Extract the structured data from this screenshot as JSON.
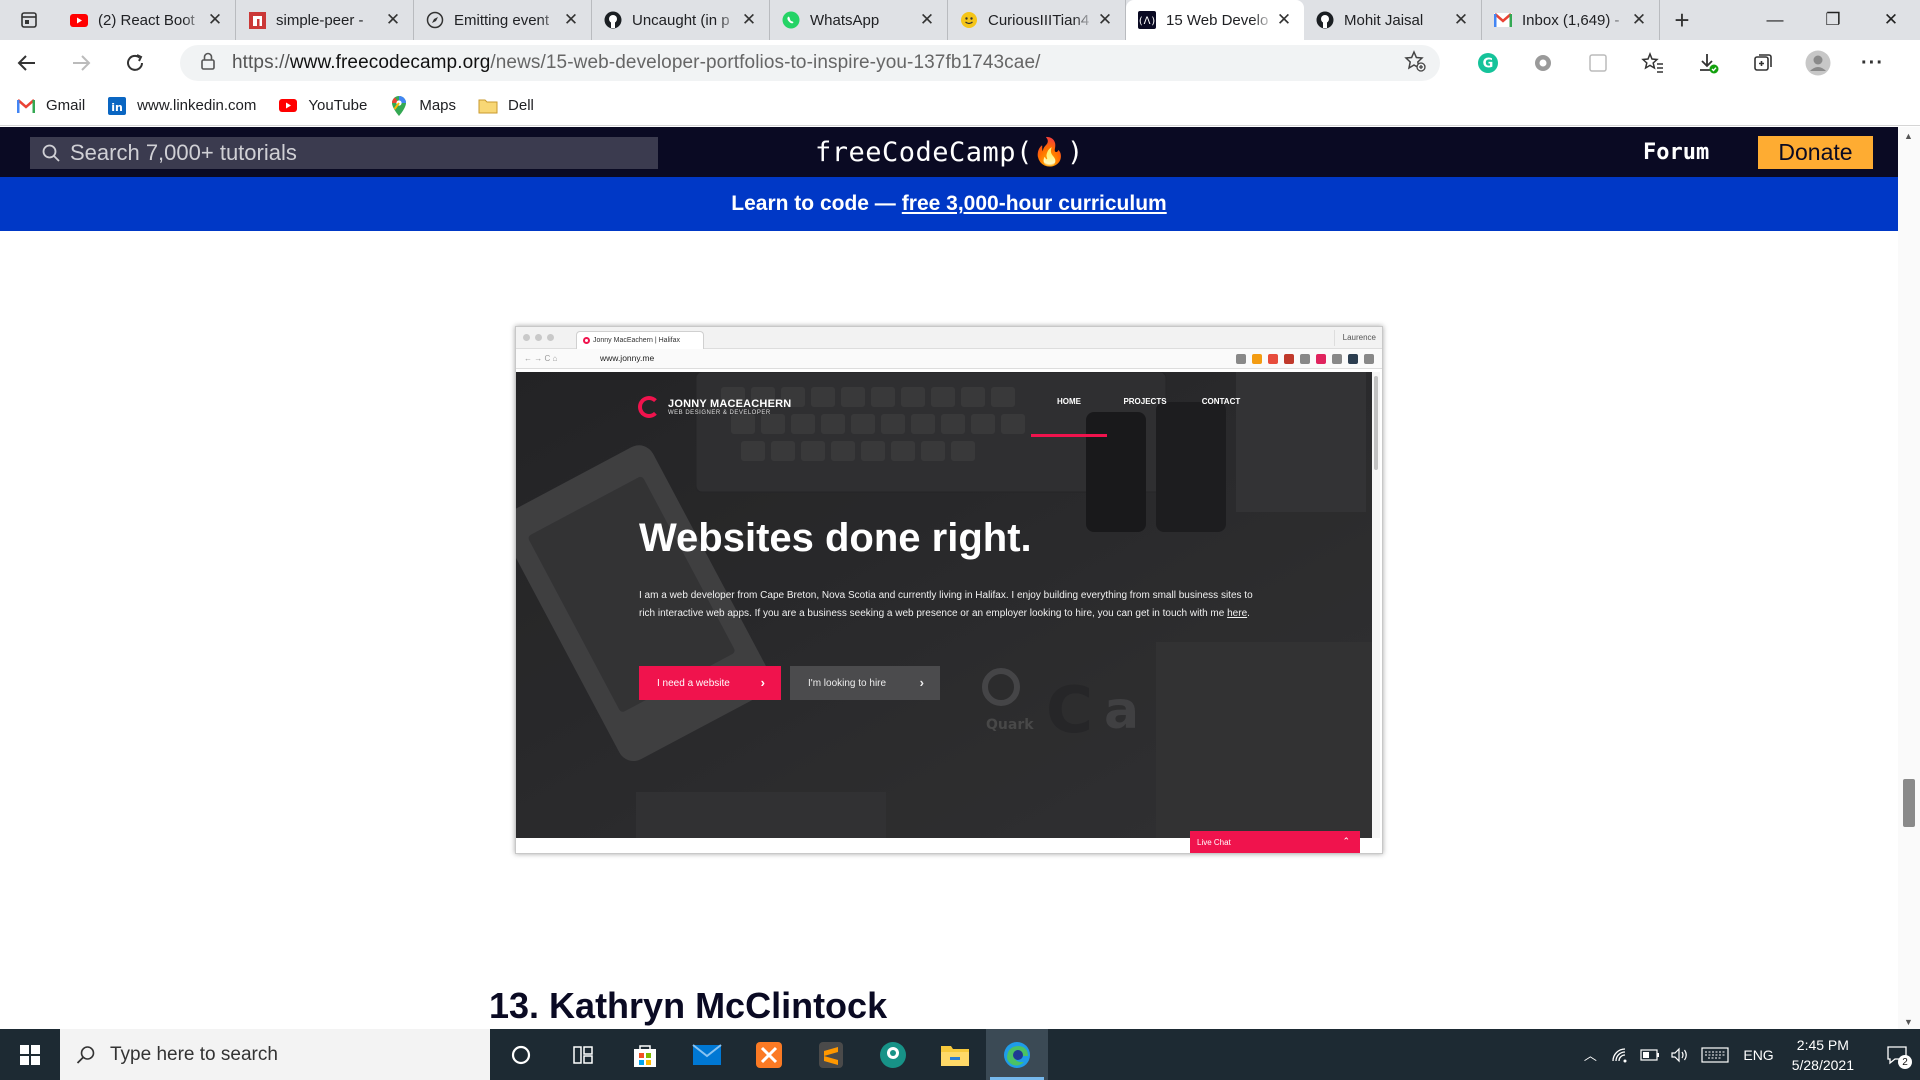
{
  "browser": {
    "tabs": [
      {
        "title": "(2) React Boot",
        "favicon": "youtube-icon"
      },
      {
        "title": "simple-peer -",
        "favicon": "npm-icon"
      },
      {
        "title": "Emitting event",
        "favicon": "compass-icon"
      },
      {
        "title": "Uncaught (in p",
        "favicon": "github-icon"
      },
      {
        "title": "WhatsApp",
        "favicon": "whatsapp-icon"
      },
      {
        "title": "CuriousIIITian4",
        "favicon": "emoji-icon"
      },
      {
        "title": "15 Web Develo",
        "favicon": "freecodecamp-icon",
        "active": true
      },
      {
        "title": "Mohit Jaisal",
        "favicon": "github-icon"
      },
      {
        "title": "Inbox (1,649) -",
        "favicon": "gmail-icon"
      }
    ],
    "url_scheme": "https://",
    "url_host": "www.freecodecamp.org",
    "url_path": "/news/15-web-developer-portfolios-to-inspire-you-137fb1743cae/",
    "bookmarks": [
      {
        "label": "Gmail",
        "icon": "gmail-icon"
      },
      {
        "label": "www.linkedin.com",
        "icon": "linkedin-icon"
      },
      {
        "label": "YouTube",
        "icon": "youtube-icon"
      },
      {
        "label": "Maps",
        "icon": "maps-icon"
      },
      {
        "label": "Dell",
        "icon": "folder-icon"
      }
    ]
  },
  "fcc": {
    "search_placeholder": "Search 7,000+ tutorials",
    "logo": "freeCodeCamp(🔥)",
    "forum": "Forum",
    "donate": "Donate",
    "banner_prefix": "Learn to code —",
    "banner_link": "free 3,000-hour curriculum"
  },
  "figure": {
    "mini_tab_title": "Jonny MacEachern | Halifax",
    "mini_user": "Laurence",
    "mini_url": "www.jonny.me",
    "logo_name": "JONNY MACEACHERN",
    "logo_sub": "WEB DESIGNER & DEVELOPER",
    "menu": [
      "HOME",
      "PROJECTS",
      "CONTACT"
    ],
    "headline": "Websites done right.",
    "body_1": "I am a web developer from Cape Breton, Nova Scotia and currently living in Halifax. I enjoy building everything from small business sites to rich interactive web apps. If you are a business seeking a web presence or an employer looking to hire, you can get in touch with me",
    "body_link": "here",
    "body_end": ".",
    "btn_primary": "I need a website",
    "btn_secondary": "I'm looking to hire",
    "live_chat": "Live Chat"
  },
  "article": {
    "next_heading": "13. Kathryn McClintock"
  },
  "taskbar": {
    "search_placeholder": "Type here to search",
    "apps": [
      "cortana-icon",
      "task-view-icon",
      "store-icon",
      "mail-icon",
      "xampp-icon",
      "sublime-icon",
      "gitkraken-icon",
      "file-explorer-icon",
      "edge-icon"
    ],
    "language": "ENG",
    "time": "2:45 PM",
    "date": "5/28/2021",
    "notifications": "2"
  }
}
